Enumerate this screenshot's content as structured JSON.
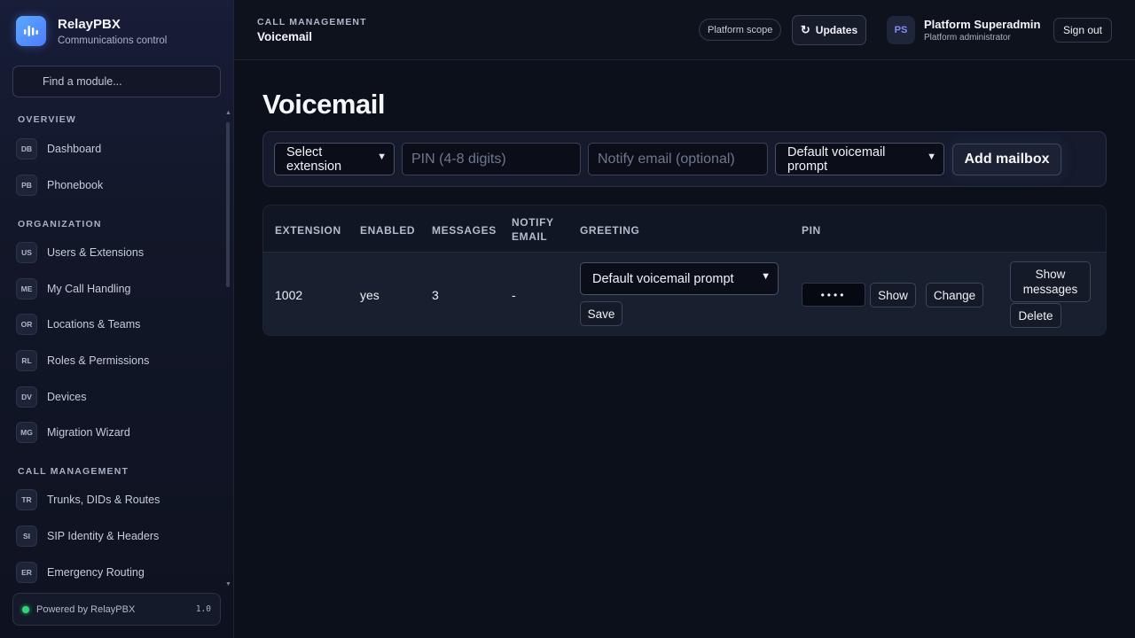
{
  "brand": {
    "name": "RelayPBX",
    "subtitle": "Communications control"
  },
  "sidebar": {
    "search_placeholder": "Find a module...",
    "sections": [
      {
        "title": "OVERVIEW",
        "items": [
          {
            "badge": "DB",
            "label": "Dashboard"
          },
          {
            "badge": "PB",
            "label": "Phonebook"
          }
        ]
      },
      {
        "title": "ORGANIZATION",
        "items": [
          {
            "badge": "US",
            "label": "Users & Extensions"
          },
          {
            "badge": "ME",
            "label": "My Call Handling"
          },
          {
            "badge": "OR",
            "label": "Locations & Teams"
          },
          {
            "badge": "RL",
            "label": "Roles & Permissions"
          },
          {
            "badge": "DV",
            "label": "Devices"
          },
          {
            "badge": "MG",
            "label": "Migration Wizard"
          }
        ]
      },
      {
        "title": "CALL MANAGEMENT",
        "items": [
          {
            "badge": "TR",
            "label": "Trunks, DIDs & Routes"
          },
          {
            "badge": "SI",
            "label": "SIP Identity & Headers"
          },
          {
            "badge": "ER",
            "label": "Emergency Routing"
          }
        ]
      }
    ],
    "footer": {
      "text": "Powered by RelayPBX",
      "version": "1.0"
    }
  },
  "header": {
    "section": "CALL MANAGEMENT",
    "title": "Voicemail",
    "scope_label": "Platform scope",
    "updates_label": "Updates",
    "user": {
      "initials": "PS",
      "name": "Platform Superadmin",
      "role": "Platform administrator"
    },
    "signout_label": "Sign out"
  },
  "page": {
    "title": "Voicemail"
  },
  "form": {
    "extension_select": "Select extension",
    "pin_placeholder": "PIN (4-8 digits)",
    "email_placeholder": "Notify email (optional)",
    "prompt_select": "Default voicemail prompt",
    "add_label": "Add mailbox"
  },
  "table": {
    "columns": [
      "EXTENSION",
      "ENABLED",
      "MESSAGES",
      "NOTIFY EMAIL",
      "GREETING",
      "PIN"
    ],
    "rows": [
      {
        "extension": "1002",
        "enabled": "yes",
        "messages": "3",
        "notify_email": "-",
        "greeting": "Default voicemail prompt",
        "save_label": "Save",
        "pin_masked": "••••",
        "show_label": "Show",
        "change_label": "Change",
        "show_messages_label": "Show messages",
        "delete_label": "Delete"
      }
    ]
  },
  "colors": {
    "accent": "#4f7bff",
    "status_ok": "#36d17a",
    "background": "#0c101a"
  }
}
